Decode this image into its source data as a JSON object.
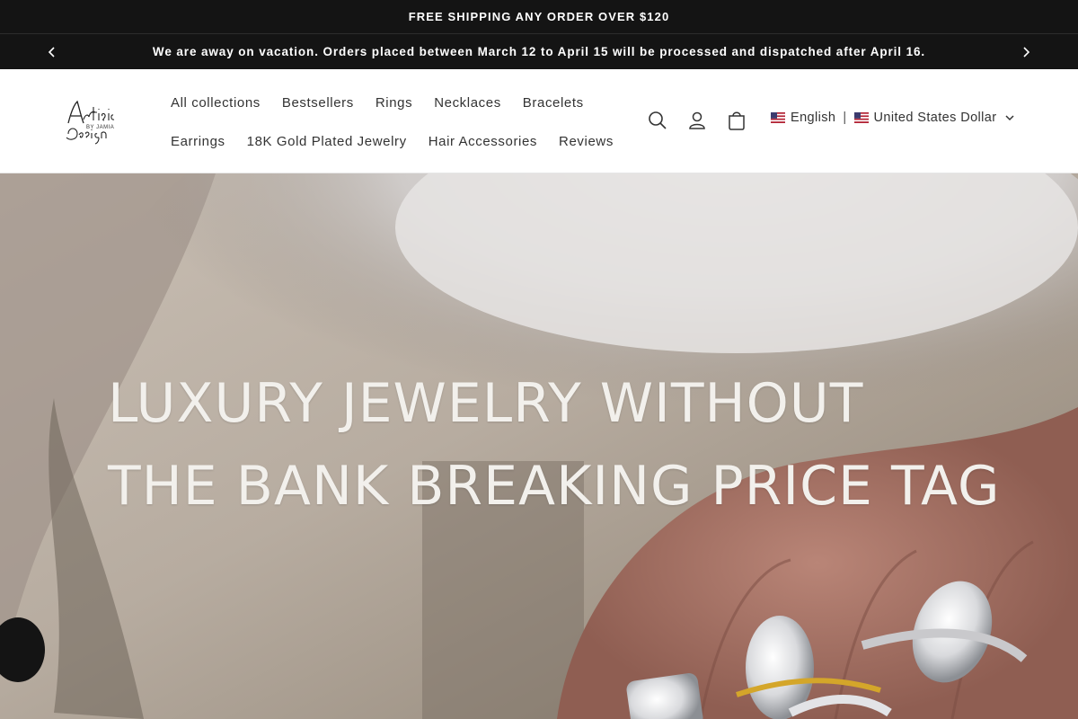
{
  "announcement": {
    "shipping": "FREE SHIPPING ANY ORDER OVER $120",
    "vacation": "We are away on vacation. Orders placed between March 12 to April 15 will be processed and dispatched after April 16."
  },
  "logo": {
    "text_line1": "Artistic",
    "text_line2": "BY JAMIA",
    "text_line3": "Design"
  },
  "nav": {
    "row1": [
      "All collections",
      "Bestsellers",
      "Rings",
      "Necklaces",
      "Bracelets"
    ],
    "row2": [
      "Earrings",
      "18K Gold Plated Jewelry",
      "Hair Accessories",
      "Reviews"
    ]
  },
  "icons": {
    "search": "search-icon",
    "account": "user-icon",
    "cart": "cart-icon"
  },
  "locale": {
    "language": "English",
    "currency": "United States Dollar"
  },
  "hero": {
    "line1": "LUXURY JEWELRY WITHOUT",
    "line2": "THE BANK BREAKING PRICE TAG"
  },
  "colors": {
    "bar": "#141414",
    "text_dark": "#333333",
    "hero_text": "#f2f0ec"
  }
}
